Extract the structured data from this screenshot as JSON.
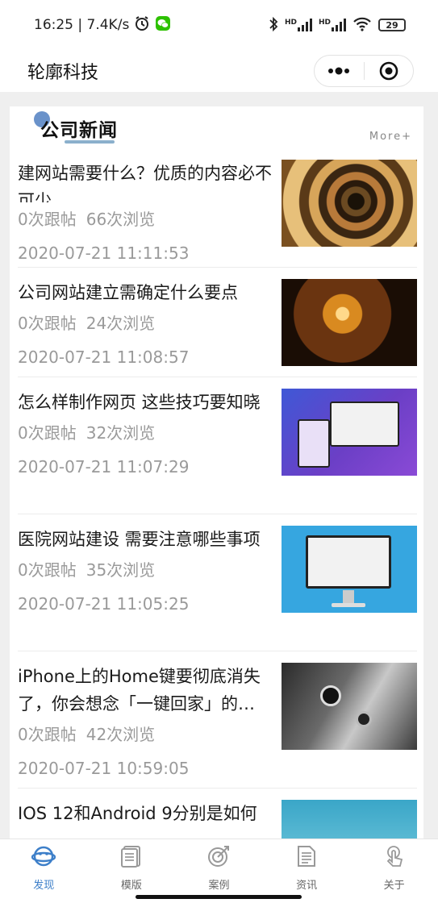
{
  "status_bar": {
    "time_speed": "16:25 | 7.4K/s",
    "hd1": "HD",
    "hd2": "HD",
    "battery": "29"
  },
  "nav": {
    "title": "轮廓科技"
  },
  "section": {
    "title": "公司新闻",
    "more": "More+"
  },
  "news": [
    {
      "title": "建网站需要什么？优质的内容必不可少",
      "replies": "0次跟帖",
      "views": "66次浏览",
      "date": "2020-07-21 11:11:53",
      "thumb_icon": "bookshelf-tunnel-image"
    },
    {
      "title": "公司网站建立需确定什么要点",
      "replies": "0次跟帖",
      "views": "24次浏览",
      "date": "2020-07-21 11:08:57",
      "thumb_icon": "dartboard-image"
    },
    {
      "title": "怎么样制作网页 这些技巧要知晓",
      "replies": "0次跟帖",
      "views": "32次浏览",
      "date": "2020-07-21 11:07:29",
      "thumb_icon": "website-mockup-image"
    },
    {
      "title": "医院网站建设 需要注意哪些事项",
      "replies": "0次跟帖",
      "views": "35次浏览",
      "date": "2020-07-21 11:05:25",
      "thumb_icon": "monitor-image"
    },
    {
      "title": "iPhone上的Home键要彻底消失了，你会想念「一键回家」的…",
      "replies": "0次跟帖",
      "views": "42次浏览",
      "date": "2020-07-21 10:59:05",
      "thumb_icon": "iphone-image"
    },
    {
      "title": "IOS 12和Android 9分别是如何",
      "thumb_icon": "partial-image"
    }
  ],
  "tabs": [
    {
      "label": "发现",
      "icon": "planet-icon",
      "active": true
    },
    {
      "label": "模版",
      "icon": "template-icon",
      "active": false
    },
    {
      "label": "案例",
      "icon": "target-icon",
      "active": false
    },
    {
      "label": "资讯",
      "icon": "document-icon",
      "active": false
    },
    {
      "label": "关于",
      "icon": "touch-icon",
      "active": false
    }
  ],
  "colors": {
    "accent": "#3d7fc9",
    "text_secondary": "#9a9a9a",
    "background": "#efefef"
  }
}
